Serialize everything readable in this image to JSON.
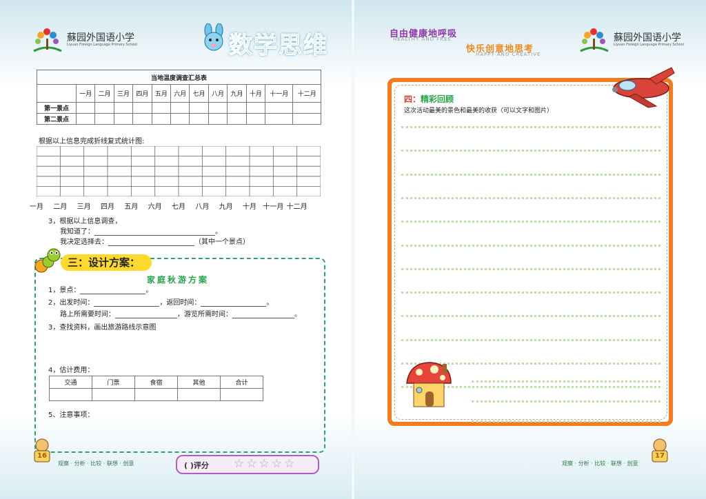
{
  "header": {
    "school_name": "蘇园外国语小学",
    "school_name_en": "Liyuan Foreign Language Primary School",
    "title": "数学思维",
    "slogan1": "自由健康地呼吸",
    "slogan1_en": "HEALTHY AND FREE",
    "slogan2": "快乐创意地思考",
    "slogan2_en": "HAPPY AND CREATIVE"
  },
  "survey": {
    "title": "当地温度调查汇总表",
    "months": [
      "一月",
      "二月",
      "三月",
      "四月",
      "五月",
      "六月",
      "七月",
      "八月",
      "九月",
      "十月",
      "十一月",
      "十二月"
    ],
    "rows": [
      "第一景点",
      "第二景点"
    ]
  },
  "chart_prompt": "根据以上信息完成折线复式统计图:",
  "chart_months": [
    "一月",
    "二月",
    "三月",
    "四月",
    "五月",
    "六月",
    "七月",
    "八月",
    "九月",
    "十月",
    "十一月",
    "十二月"
  ],
  "q3": {
    "line1": "3，根据以上信息调查，",
    "line2": "我知道了：",
    "line2_end": "。",
    "line3": "我决定选择去：",
    "line3_end": "（其中一个景点）"
  },
  "section3": {
    "title": "三：设计方案：",
    "plan_title": "家庭秋游方案",
    "item1": "1，景点：",
    "item1_end": "。",
    "item2a": "2，出发时间：",
    "item2b": "，返回时间：",
    "item2_end": "。",
    "item2c": "路上所需要时间：",
    "item2d": "，游览所需时间：",
    "item2c_end": "。",
    "item3": "3，查找资料，画出旅游路线示意图",
    "item4": "4，估计费用：",
    "cost_headers": [
      "交通",
      "门票",
      "食宿",
      "其他",
      "合计"
    ],
    "item5": "5、注意事项："
  },
  "section4": {
    "title_prefix": "四：",
    "title_main": "精彩回顾",
    "desc": "这次活动最美的景色和最美的收获（可以文字和图片）"
  },
  "footer": {
    "left_page": "16",
    "right_page": "17",
    "motto_left": "观察 · 分析 · 比较 · 联想 · 创意",
    "motto_right": "观察 · 分析 · 比较 · 联想 · 创意",
    "score_label": "(        )评分",
    "stars": "☆☆☆☆☆"
  },
  "colors": {
    "accent_green": "#29a36a",
    "frame_orange": "#f47c1f",
    "frame_yellow": "#ffcc22",
    "title_blue": "#4ec0e8",
    "section_yellow": "#ffd92e"
  }
}
